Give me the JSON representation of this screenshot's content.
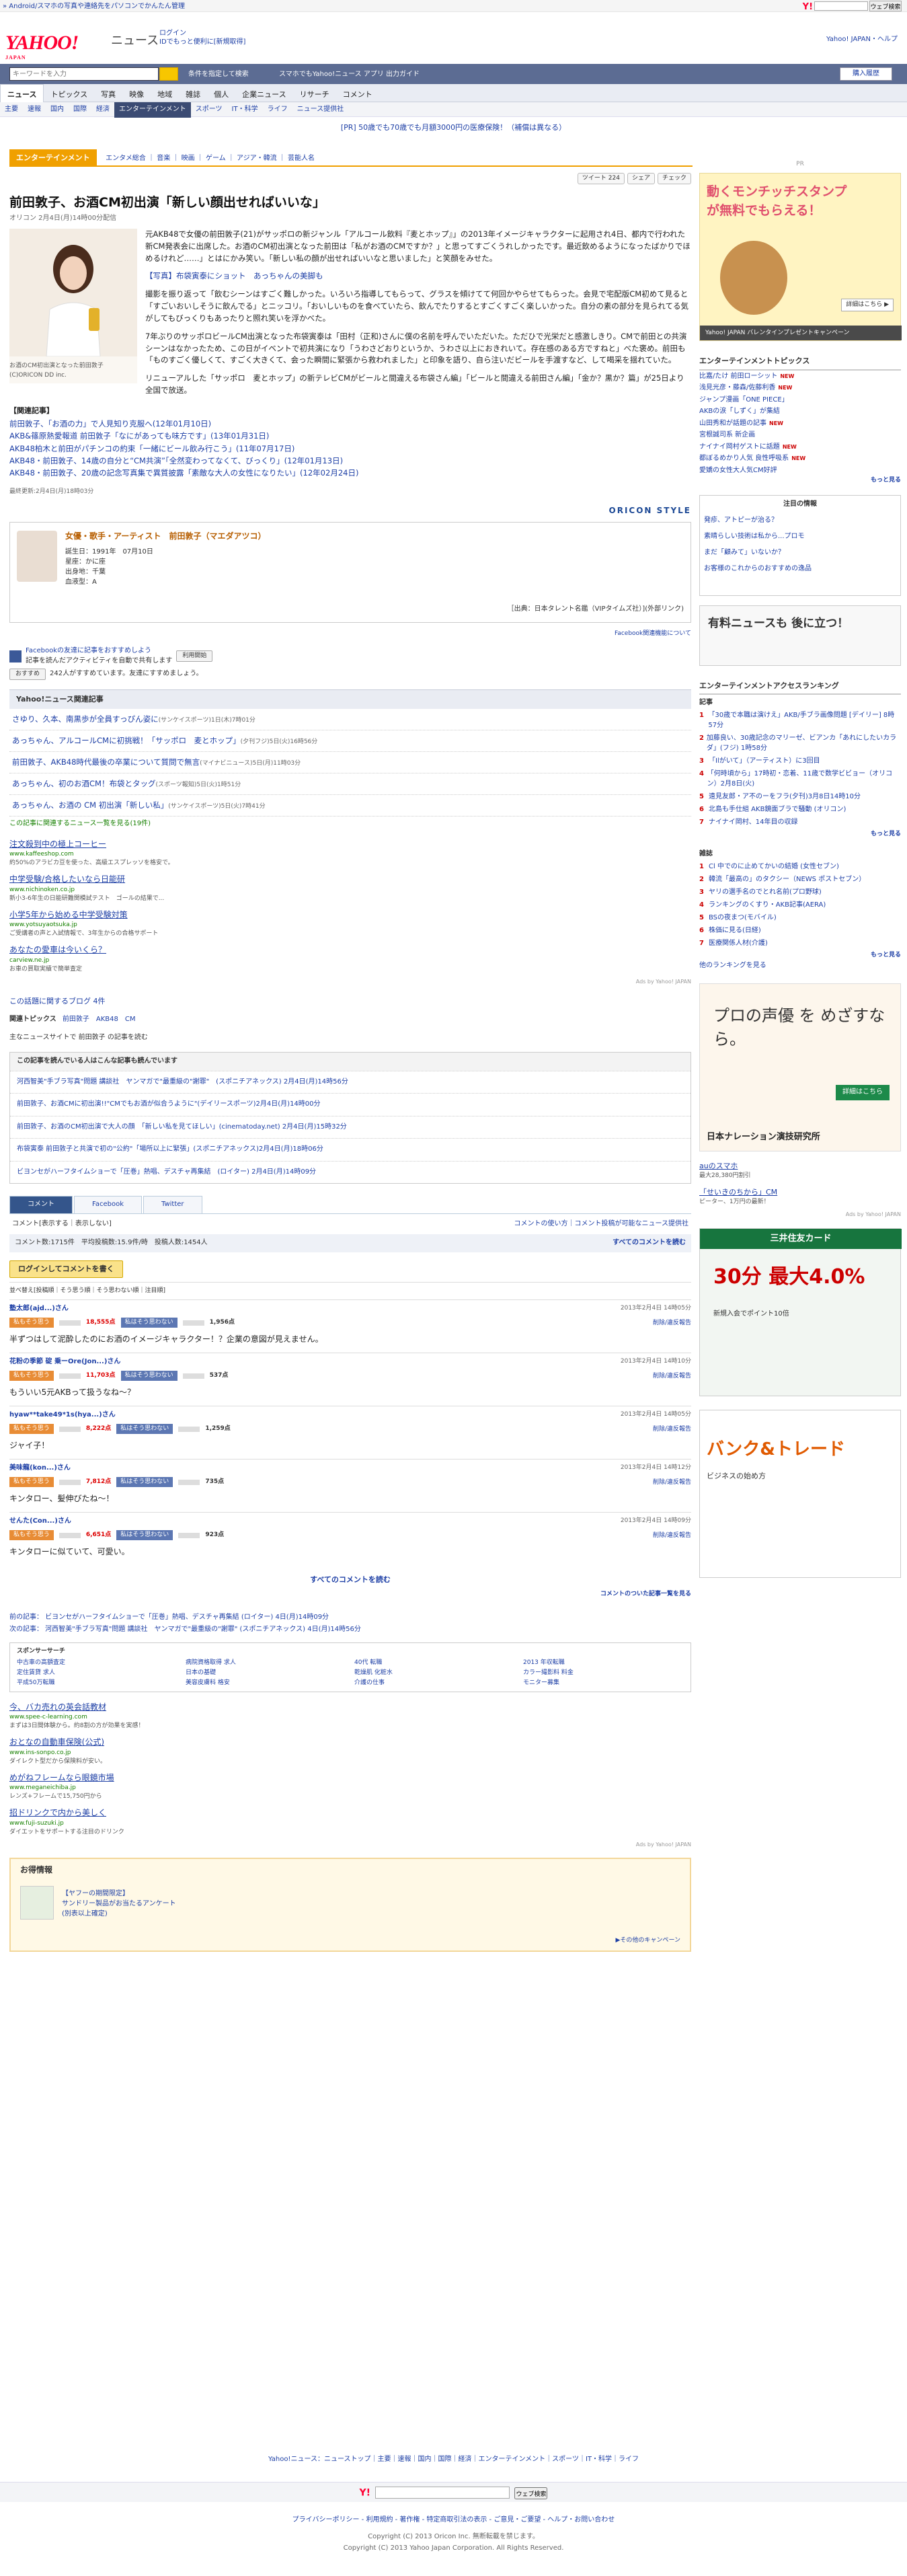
{
  "utility": {
    "notice": "» Android/スマホの写真や連絡先をパソコンでかんたん管理",
    "yahoo": "Y!",
    "search_btn": "ウェブ検索"
  },
  "header": {
    "logo": "YAHOO!",
    "logo_sub": "JAPAN",
    "service": "ニュース",
    "login": "ログイン",
    "login_sub": "IDでもっと便利に[新規取得]",
    "toplinks": "Yahoo! JAPAN・ヘルプ"
  },
  "search": {
    "placeholder": "キーワードを入力",
    "search_links": "条件を指定して検索",
    "extras": "スマホでもYahoo!ニュース アプリ 出力ガイド",
    "buy": "購入履歴"
  },
  "gnav": [
    "ニュース",
    "トピックス",
    "写真",
    "映像",
    "地域",
    "雑誌",
    "個人",
    "企業ニュース",
    "リサーチ",
    "コメント"
  ],
  "subnav": [
    "主要",
    "速報",
    "国内",
    "国際",
    "経済",
    "エンターテインメント",
    "スポーツ",
    "IT・科学",
    "ライフ",
    "ニュース提供社"
  ],
  "pr": "[PR] 50歳でも70歳でも月額3000円の医療保険！（補償は異なる）",
  "ent": {
    "tag": "エンターテインメント",
    "subs": "エンタメ総合 ｜ 音楽 ｜ 映画 ｜ ゲーム ｜ アジア・韓流 ｜ 芸能人名"
  },
  "share": [
    "ツイート 224",
    "シェア",
    "チェック"
  ],
  "article": {
    "title": "前田敦子、お酒CM初出演「新しい顔出せればいいな」",
    "source": "オリコン 2月4日(月)14時00分配信",
    "p1": "元AKB48で女優の前田敦子(21)がサッポロの新ジャンル「アルコール飲料『麦とホップ』」の2013年イメージキャラクターに起用され4日、都内で行われた新CM発表会に出席した。お酒のCM初出演となった前田は「私がお酒のCMですか？」と思ってすごくうれしかったです。最近飲めるようになったばかりでほめるけれど……」とはにかみ笑い。「新しい私の顔が出せればいいなと思いました」と笑顔をみせた。",
    "link": "【写真】布袋寅泰にショット　あっちゃんの美脚も",
    "p2": "撮影を振り返って「飲むシーンはすごく難しかった。いろいろ指導してもらって、グラスを傾けてて何回かやらせてもらった。会見で宅配版CM初めて見ると「すごいおいしそうに飲んでる」とニッコリ。「おいしいものを食べていたら、飲んでたりするとすごくすごく楽しいかった。自分の素の部分を見られてる気がしてもびっくりもあったりと照れ笑いを浮かべた。",
    "p3": "7年ぶりのサッポロビールCM出演となった布袋寅泰は「田村（正和)さんに僕の名前を呼んでいただいた。ただひで光栄だと感激しきり。CMで前田との共演シーンはなかったため、この日がイベントで初共演になり「うわさどおりというか、うわさ以上におきれいて。存在感のある方ですねと」べた褒め。前田も「ものすごく優しくて、すごく大きくて、会った瞬間に緊張から救われました」と印象を語り、自ら注いだビールを手渡すなど、して喝采を揺れていた。",
    "p4": "リニューアルした「サッポロ　麦とホップ」の新テレビCMがビールと間違える布袋さん編」「ビールと間違える前田さん編」「金か？黒か？篇」が25日より全国で放送。",
    "caption": "お酒のCM初出演となった前田敦子 (C)ORICON DD inc.",
    "related_title": "【関連記事】",
    "related": [
      "前田敦子、「お酒の力」で人見知り克服へ(12年01月10日)",
      "AKB&篠原熱愛報道 前田敦子「なにがあっても味方です」(13年01月31日)",
      "AKB48柏木と前田がパチンコの約束「一緒にビール飲み行こう」(11年07月17日)",
      "AKB48・前田敦子、14歳の自分と“CM共演”「全然変わってなくて、びっくり」(12年01月13日)",
      "AKB48・前田敦子、20歳の記念写真集で異質披露「素敵な大人の女性になりたい」(12年02月24日)"
    ],
    "updated": "最終更新:2月4日(月)18時03分"
  },
  "oricon_logo": "ORICON STYLE",
  "profile": {
    "name": "女優・歌手・アーティスト　前田敦子（マエダアツコ）",
    "details": [
      "誕生日：1991年　07月10日",
      "星座：かに座",
      "出身地：千葉",
      "血液型：A"
    ],
    "footer": "［出典：日本タレント名鑑（VIPタイムズ社）](外部リンク)"
  },
  "fb": {
    "more": "Facebook関連機能について",
    "line1": "Facebookの友達に記事をおすすめしよう",
    "line2": "記事を読んだアクティビティを自動で共有します",
    "btn": "利用開始",
    "like": "おすすめ",
    "like_count": "242人がすすめています。友達にすすめましょう。"
  },
  "yahoo_related": {
    "title": "Yahoo!ニュース関連記事",
    "items": [
      {
        "t": "さゆり、久本、南黒歩が全員すっぴん姿に",
        "s": "(サンケイスポーツ)1日(木)7時01分"
      },
      {
        "t": "あっちゃん、アルコールCMに初挑戦！「サッポロ　麦とホップ」",
        "s": "(夕刊フジ)5日(火)16時56分"
      },
      {
        "t": "前田敦子、AKB48時代最後の卒業について質問で無言",
        "s": "(マイナビニュース)5日(月)11時03分"
      },
      {
        "t": "あっちゃん、初のお酒CM！布袋とタッグ",
        "s": "(スポーツ報知)5日(火)1時51分"
      },
      {
        "t": "あっちゃん、お酒の CM 初出演「新しい私」",
        "s": "(サンケイスポーツ)5日(火)7時41分"
      }
    ],
    "more": "この記事に関連するニュース一覧を見る(19件)"
  },
  "ads": [
    {
      "t": "注文殺到中の極上コーヒー",
      "u": "www.kaffeeshop.com",
      "d": "約50%のアラビカ豆を使った、高級エスプレッソを格安で。"
    },
    {
      "t": "中学受験/合格したいなら日能研",
      "u": "www.nichinoken.co.jp",
      "d": "新小3-6年生の日能研難関模試テスト　ゴールの結果で..."
    },
    {
      "t": "小学5年から始める中学受験対策",
      "u": "www.yotsuyaotsuka.jp",
      "d": "ご受講者の声と入試情報で、3年生からの合格サポート"
    },
    {
      "t": "あなたの愛車は今いくら？",
      "u": "carview.ne.jp",
      "d": "お車の買取実績で簡単査定"
    }
  ],
  "ads_by": "Ads by Yahoo! JAPAN",
  "blog": "この話題に関するブログ 4件",
  "kw": {
    "label": "関連トピックス",
    "items": [
      "前田敦子",
      "AKB48",
      "CM"
    ]
  },
  "author": "主なニュースサイトで 前田敦子 の記事を読む",
  "readers": {
    "title": "この記事を読んでいる人はこんな記事も読んでいます",
    "items": [
      "河西智美\"手ブラ写真\"問題 講談社　ヤンマガで\"最重級の\"謝罪\"　(スポニチアネックス) 2月4日(月)14時56分",
      "前田敦子、お酒CMに初出演!!\"CMでもお酒が似合うように\"(デイリースポーツ)2月4日(月)14時00分",
      "前田敦子、お酒のCM初出演で大人の顔　「新しい私を見てほしい」(cinematoday.net) 2月4日(月)15時32分",
      "布袋寅泰 前田敦子と共演で初の\"公約\"「場所以上に緊張」(スポニチアネックス)2月4日(月)18時06分",
      "ビヨンセがハーフタイムショーで「圧巻」熱唱、デスチャ再集結　(ロイター) 2月4日(月)14時09分"
    ]
  },
  "tabs": [
    "コメント",
    "Facebook",
    "Twitter"
  ],
  "comments_meta": {
    "toggle": "コメント[表示する｜表示しない]",
    "right": "コメントの使い方｜コメント投稿が可能なニュース提供社",
    "count": "コメント数:1715件　平均投稿数:15.9件/時　投稿人数:1454人",
    "all": "すべてのコメントを読む",
    "login": "ログインしてコメントを書く",
    "sort": "並べ替え[投稿順｜そう思う順｜そう思わない順｜注目順]",
    "all2": "すべてのコメントを読む",
    "list": "コメントのついた記事一覧を見る"
  },
  "comments": [
    {
      "u": "塾太郎(ajd...)さん",
      "d": "2013年2月4日 14時05分",
      "yes": "18,555点",
      "no": "1,956点",
      "t": "半ずつはして泥酔したのにお酒のイメージキャラクター！？企業の意図が見えません。"
    },
    {
      "u": "花粉の季節 碇 乗ーOre(Jon...)さん",
      "d": "2013年2月4日 14時10分",
      "yes": "11,703点",
      "no": "537点",
      "t": "もういい5元AKBって扱うなね〜？"
    },
    {
      "u": "hyaw**take49*1s(hya...)さん",
      "d": "2013年2月4日 14時05分",
      "yes": "8,222点",
      "no": "1,259点",
      "t": "ジャイ子！"
    },
    {
      "u": "美味龍(kon...)さん",
      "d": "2013年2月4日 14時12分",
      "yes": "7,812点",
      "no": "735点",
      "t": "キンタロー、髪伸びたね〜！"
    },
    {
      "u": "せんた(Con...)さん",
      "d": "2013年2月4日 14時09分",
      "yes": "6,651点",
      "no": "923点",
      "t": "キンタローに似ていて、可愛い。"
    }
  ],
  "vote": {
    "yes": "私もそう思う",
    "no": "私はそう思わない",
    "report": "削除/違反報告"
  },
  "nav": {
    "prev": "前の記事： ビヨンセがハーフタイムショーで「圧巻」熱唱、デスチャ再集結 (ロイター) 4日(月)14時09分",
    "next": "次の記事： 河西智美\"手ブラ写真\"問題 講談社　ヤンマガで\"最重級の\"謝罪\" (スポニチアネックス) 4日(月)14時56分"
  },
  "sponsor": {
    "title": "スポンサーサーチ",
    "items": [
      "中古車の高額査定",
      "病院資格取得 求人",
      "40代 転職",
      "2013 年収転職",
      "定住賃貸 求人",
      "日本の基礎",
      "乾燥肌 化粧水",
      "カラー撮影料 料金",
      "平成50万転職",
      "美容皮膚科 格安",
      "介護の仕事",
      "モニター募集"
    ]
  },
  "ads2": [
    {
      "t": "今、バカ売れの英会話教材",
      "u": "www.spee-c-learning.com",
      "d": "まずは3日間体験から。約8割の方が効果を実感！"
    },
    {
      "t": "おとなの自動車保険(公式)",
      "u": "www.ins-sonpo.co.jp",
      "d": "ダイレクト型だから保険料が安い。"
    },
    {
      "t": "めがねフレームなら眼鏡市場",
      "u": "www.meganeichiba.jp",
      "d": "レンズ+フレームで15,750円から"
    },
    {
      "t": "招ドリンクで内から美しく",
      "u": "www.fuji-suzuki.jp",
      "d": "ダイエットをサポートする注目のドリンク"
    }
  ],
  "oshirase": {
    "title": "お得情報",
    "items": [
      "【ヤフーの期間限定】",
      "サンドリー製品がお当たるアンケート",
      "(別表以上確定)"
    ],
    "more": "▶その他のキャンペーン"
  },
  "footer": {
    "links": "Yahoo!ニュース：ニューストップ｜主要｜速報｜国内｜国際｜経済｜エンターテインメント｜スポーツ｜IT・科学｜ライフ",
    "yahoo": "Y!",
    "btn": "ウェブ検索",
    "policy": "プライバシーポリシー - 利用規約 - 著作権 - 特定商取引法の表示 - ご意見・ご要望 - ヘルプ・お問い合わせ",
    "copy1": "Copyright (C) 2013 Oricon Inc. 無断転載を禁じます。",
    "copy2": "Copyright (C) 2013 Yahoo Japan Corporation. All Rights Reserved."
  },
  "side": {
    "pr": "PR",
    "stamp1": "動くモンチッチスタンプ",
    "stamp2": "が無料でもらえる！",
    "dl": "詳細はこちら ▶",
    "stamp_bar": "Yahoo! JAPAN バレンタインプレゼントキャンペーン",
    "topics_title": "エンターテインメントトピックス",
    "topics": [
      "比嘉/たけ 前田ローシット",
      "浅見光彦・藤森/佐藤利香",
      "ジャンプ漫画「ONE PIECE」",
      "AKBの涙「しずく」が集結",
      "山田秀和が話題の記事",
      "宮根誠司系 新企画",
      "ナイナイ岡村ゲストに話題",
      "都ぼるめかり人気 良性呼吸系",
      "愛嬌の女性大人気CM好評"
    ],
    "new": "NEW",
    "more": "もっと見る",
    "attention_title": "注目の情報",
    "attention": [
      "発疹、アトピーが治る？",
      "素晴らしい技術は私から...プロモ",
      "まだ「顧みて」いないか？",
      "お客様のこれからのおすすめの逸品"
    ],
    "ad_banner": "有料ニュースも 後に立つ！",
    "ranking_title": "エンターテインメントアクセスランキング",
    "ranking_sub": "記事",
    "ranking": [
      "「30歳で本職は演けえ」AKB/手ブラ画像問題 [デイリー] 8時57分",
      "加藤良い、30歳記念のマリーゼ、ビアンカ「あれにしたいカラダ」(フジ) 1時58分",
      "「Ilがいて」（アーティスト）に3回目",
      "「何時頃から」17時初・恋着、11歳で数学ビビョー（オリコン）2月8日(火)",
      "遠見友郎・ア不のーをフラ(夕刊)3月8日14時10分",
      "北島も手仕組 AKB鏡面ブラで騒動 (オリコン)",
      "ナイナイ岡村、14年目の収録"
    ],
    "zasshi_title": "雑誌",
    "zasshi": [
      "Cl 中でのに止めてかいの結婚 (女性セブン)",
      "韓流「最高の」のタクシー（NEWS ポストセブン）",
      "ヤリの選手名のでとれ名前(プロ野球)",
      "ランキングのくすり・AKB記事(AERA)",
      "BSの夜まつ(モバイル)",
      "株価に見る(日経)",
      "医療関係人材(介護)"
    ],
    "rank_link": "他のランキングを見る",
    "pr2": "プロの声優 を めざすなら。",
    "pr2_btn": "詳細はこちら",
    "pr2_b": "日本ナレーション演技研究所",
    "smad": [
      {
        "t": "auのスマホ",
        "d": "最大28,380円割引"
      },
      {
        "t": "「せいきのちから」CM",
        "d": "ピーター、1万円の最新！"
      }
    ],
    "cc_title": "三井住友カード",
    "cc_rate": "30分 最大4.0%",
    "cc_desc": "新規入会でポイント10倍",
    "bb_title": "バンク&トレード",
    "bb_desc": "ビジネスの始め方"
  }
}
